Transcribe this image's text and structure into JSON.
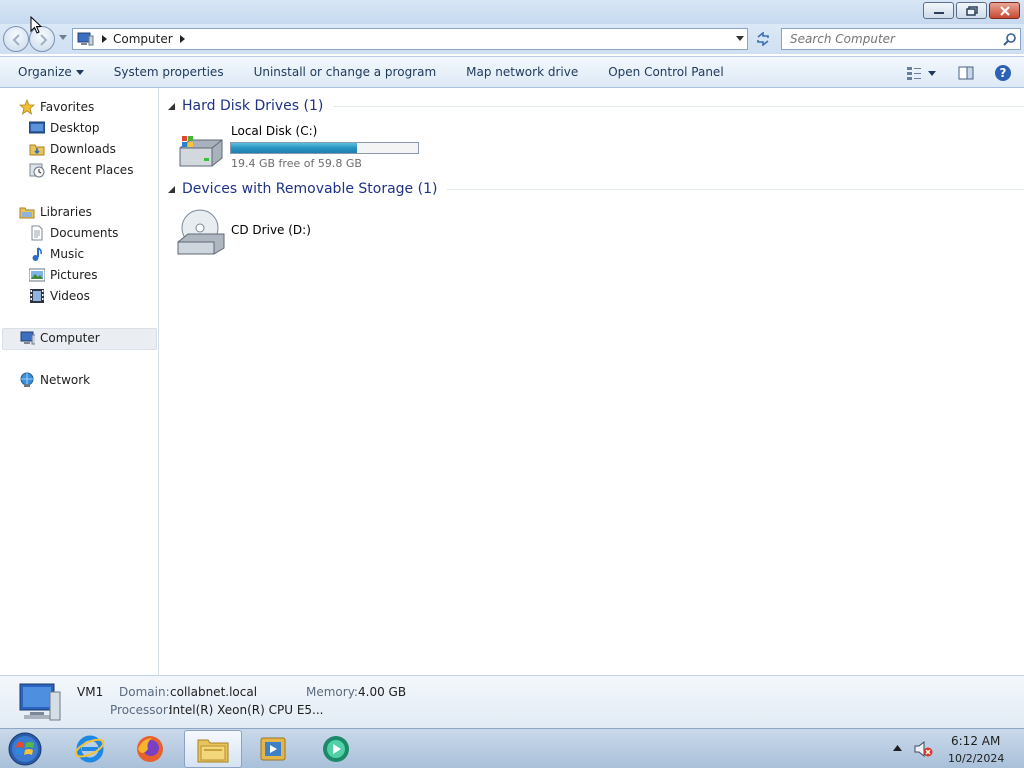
{
  "window": {
    "title": "",
    "controls": {
      "minimize": "minimize-icon",
      "maximize": "restore-icon",
      "close": "close-icon"
    }
  },
  "address": {
    "icon": "computer-icon",
    "breadcrumb": [
      "Computer"
    ]
  },
  "search": {
    "placeholder": "Search Computer"
  },
  "toolbar": {
    "organize": "Organize",
    "system_properties": "System properties",
    "uninstall": "Uninstall or change a program",
    "map_drive": "Map network drive",
    "control_panel": "Open Control Panel"
  },
  "sidebar": {
    "favorites": {
      "label": "Favorites",
      "items": [
        {
          "label": "Desktop"
        },
        {
          "label": "Downloads"
        },
        {
          "label": "Recent Places"
        }
      ]
    },
    "libraries": {
      "label": "Libraries",
      "items": [
        {
          "label": "Documents"
        },
        {
          "label": "Music"
        },
        {
          "label": "Pictures"
        },
        {
          "label": "Videos"
        }
      ]
    },
    "computer": {
      "label": "Computer",
      "selected": true
    },
    "network": {
      "label": "Network"
    }
  },
  "groups": {
    "hard_disks": {
      "title": "Hard Disk Drives (1)",
      "drives": [
        {
          "name": "Local Disk (C:)",
          "free_text": "19.4 GB free of 59.8 GB",
          "used_fraction": 0.676
        }
      ]
    },
    "removable": {
      "title": "Devices with Removable Storage (1)",
      "drives": [
        {
          "name": "CD Drive (D:)"
        }
      ]
    }
  },
  "details": {
    "name": "VM1",
    "domain_label": "Domain:",
    "domain_value": "collabnet.local",
    "memory_label": "Memory:",
    "memory_value": "4.00 GB",
    "processor_label": "Processor:",
    "processor_value": "Intel(R) Xeon(R) CPU E5..."
  },
  "taskbar": {
    "apps": [
      "internet-explorer-icon",
      "firefox-icon",
      "file-explorer-icon",
      "media-player-icon",
      "app-icon"
    ],
    "active_app": "file-explorer-icon",
    "time": "6:12 AM",
    "date": "10/2/2024"
  },
  "colors": {
    "accent": "#1e3287",
    "progress": "#2a93c2",
    "selection": "#eaeef3"
  }
}
